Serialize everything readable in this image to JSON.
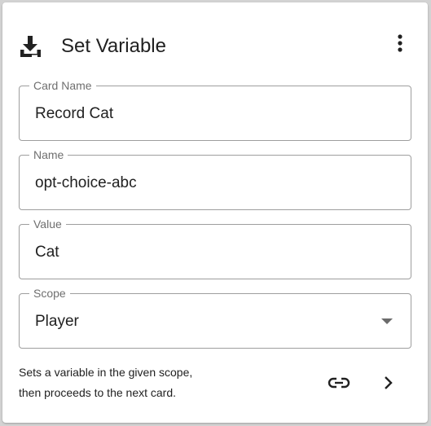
{
  "card": {
    "title": "Set Variable",
    "icon": "download-icon",
    "menu_icon": "more-vert-icon"
  },
  "fields": {
    "card_name": {
      "label": "Card Name",
      "value": "Record Cat"
    },
    "name": {
      "label": "Name",
      "value": "opt-choice-abc"
    },
    "value": {
      "label": "Value",
      "value": "Cat"
    },
    "scope": {
      "label": "Scope",
      "value": "Player"
    }
  },
  "description": {
    "line1": "Sets a variable in the given scope,",
    "line2": "then proceeds to the next card."
  },
  "actions": {
    "link_icon": "link-icon",
    "next_icon": "chevron-right-icon"
  },
  "colors": {
    "text": "#212121",
    "label": "#6f6f6f",
    "border": "#9e9e9e",
    "background": "#d3d3d3"
  }
}
